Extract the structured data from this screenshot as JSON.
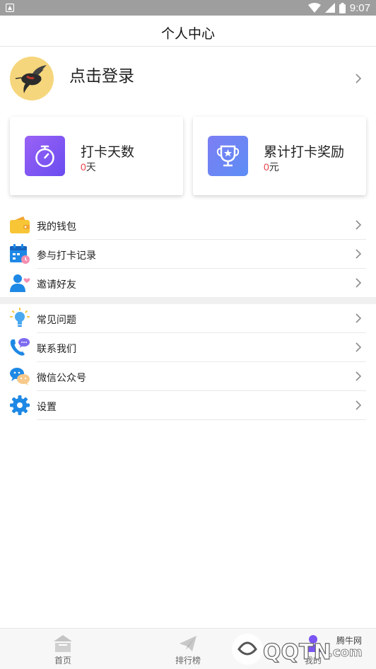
{
  "status_bar": {
    "time": "9:07"
  },
  "header": {
    "title": "个人中心"
  },
  "profile": {
    "login_text": "点击登录"
  },
  "stats": [
    {
      "title": "打卡天数",
      "value": "0",
      "unit": "天",
      "icon": "stopwatch-icon"
    },
    {
      "title": "累计打卡奖励",
      "value": "0",
      "unit": "元",
      "icon": "trophy-icon"
    }
  ],
  "menu_group_1": [
    {
      "label": "我的钱包",
      "icon": "wallet-icon"
    },
    {
      "label": "参与打卡记录",
      "icon": "calendar-icon"
    },
    {
      "label": "邀请好友",
      "icon": "invite-user-icon"
    }
  ],
  "menu_group_2": [
    {
      "label": "常见问题",
      "icon": "lightbulb-icon"
    },
    {
      "label": "联系我们",
      "icon": "phone-chat-icon"
    },
    {
      "label": "微信公众号",
      "icon": "wechat-icon"
    },
    {
      "label": "设置",
      "icon": "gear-icon"
    }
  ],
  "bottom_nav": [
    {
      "label": "首页",
      "icon": "home-icon"
    },
    {
      "label": "排行榜",
      "icon": "paper-plane-icon"
    },
    {
      "label": "我的",
      "icon": "user-icon"
    }
  ],
  "watermark": {
    "text": "QQTN",
    "suffix": ".com",
    "site": "腾牛网"
  },
  "colors": {
    "accent_red": "#e8414a",
    "purple": "#7b55f3",
    "blue": "#1e88e5",
    "wallet_yellow": "#f7c535"
  }
}
